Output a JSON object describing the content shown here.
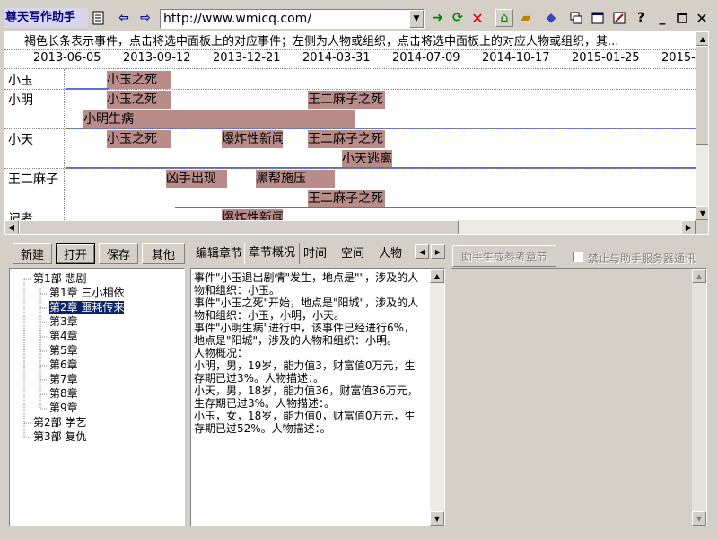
{
  "app": {
    "title": "尊天写作助手"
  },
  "address": {
    "url": "http://www.wmicq.com/"
  },
  "timeline": {
    "description": "褐色长条表示事件，点击将选中面板上的对应事件；左侧为人物或组织，点击将选中面板上的对应人物或组织，其...",
    "dates": [
      "2013-06-05",
      "2013-09-12",
      "2013-12-21",
      "2014-03-31",
      "2014-07-09",
      "2014-10-17",
      "2015-01-25",
      "2015-"
    ],
    "rows": [
      {
        "label": "小玉",
        "events": [
          "小玉之死"
        ]
      },
      {
        "label": "小明",
        "events": [
          "小玉之死",
          "王二麻子之死",
          "小明生病"
        ]
      },
      {
        "label": "小天",
        "events": [
          "小玉之死",
          "爆炸性新闻",
          "王二麻子之死",
          "小天逃离"
        ]
      },
      {
        "label": "王二麻子",
        "events": [
          "凶手出现",
          "黑帮施压",
          "王二麻子之死"
        ]
      },
      {
        "label": "记者",
        "events": [
          "爆炸性新闻"
        ]
      }
    ]
  },
  "buttons": {
    "new": "新建",
    "open": "打开",
    "save": "保存",
    "other": "其他"
  },
  "tree": [
    {
      "label": "第1部 悲剧"
    },
    {
      "label": "第1章 三小相依"
    },
    {
      "label": "第2章 噩耗传来",
      "selected": true
    },
    {
      "label": "第3章"
    },
    {
      "label": "第4章"
    },
    {
      "label": "第5章"
    },
    {
      "label": "第6章"
    },
    {
      "label": "第7章"
    },
    {
      "label": "第8章"
    },
    {
      "label": "第9章"
    },
    {
      "label": "第2部 学艺"
    },
    {
      "label": "第3部 复仇"
    }
  ],
  "tabs": [
    "编辑章节",
    "章节概况",
    "时间",
    "空间",
    "人物"
  ],
  "active_tab": "章节概况",
  "chapter_text": "事件\"小玉退出剧情\"发生，地点是\"\"，涉及的人物和组织：小玉。\n事件\"小玉之死\"开始，地点是\"阳城\"，涉及的人物和组织：小玉，小明，小天。\n事件\"小明生病\"进行中，该事件已经进行6%，地点是\"阳城\"，涉及的人物和组织：小明。\n人物概况：\n小明，男，19岁，能力值3，财富值0万元，生存期已过3%。人物描述：。\n小天，男，18岁，能力值36，财富值36万元，生存期已过3%。人物描述：。\n小玉，女，18岁，能力值0，财富值0万元，生存期已过52%。人物描述：。",
  "assist": {
    "generate_label": "助手生成参考章节",
    "disable_label": "禁止与助手服务器通讯"
  },
  "colors": {
    "event_bar": "#b98b89",
    "row_separator": "#5b6bd0",
    "selection": "#0a246a"
  }
}
